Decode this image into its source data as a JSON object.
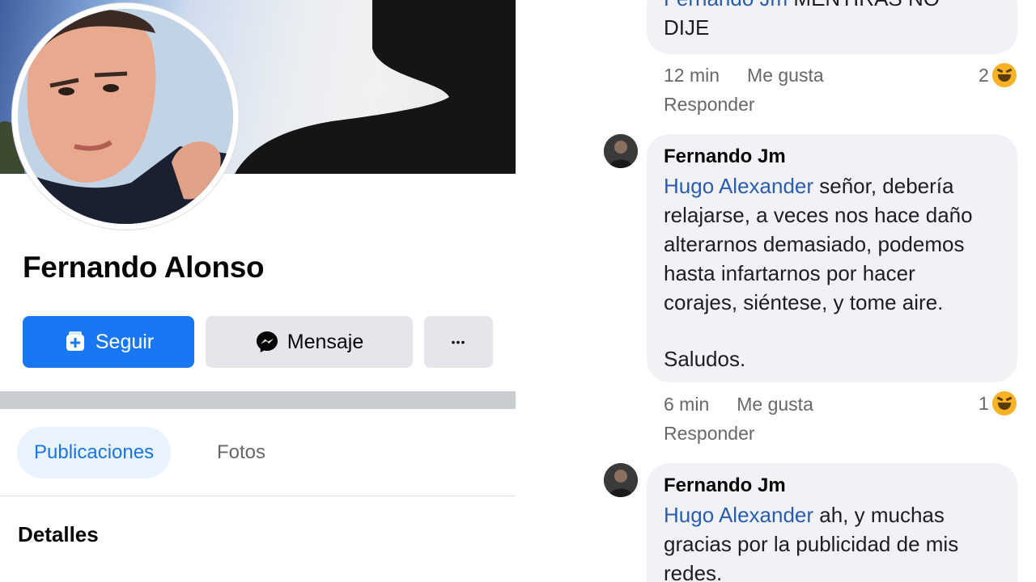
{
  "profile": {
    "name": "Fernando Alonso",
    "follow_label": "Seguir",
    "message_label": "Mensaje",
    "more_label": "•••",
    "tabs": [
      {
        "label": "Publicaciones",
        "active": true
      },
      {
        "label": "Fotos",
        "active": false
      }
    ],
    "details_heading": "Detalles",
    "accent_color": "#1877f2"
  },
  "comments": [
    {
      "author": "",
      "mention": "Fernando Jm",
      "text_line1_rest": " MENTIRAS NO",
      "text_line2": "DIJE",
      "time": "12 min",
      "like_label": "Me gusta",
      "reply_label": "Responder",
      "reaction_count": "2",
      "reaction_icon": "haha-emoji-icon"
    },
    {
      "author": "Fernando Jm",
      "mention": "Hugo Alexander",
      "lines": [
        " señor, debería",
        "relajarse, a veces nos hace daño",
        "alterarnos demasiado, podemos",
        "hasta infartarnos por hacer",
        "corajes, siéntese, y tome aire.",
        "",
        "Saludos."
      ],
      "time": "6 min",
      "like_label": "Me gusta",
      "reply_label": "Responder",
      "reaction_count": "1",
      "reaction_icon": "haha-emoji-icon"
    },
    {
      "author": "Fernando Jm",
      "mention": "Hugo Alexander",
      "lines": [
        " ah, y muchas",
        "gracias por la publicidad de mis",
        "redes."
      ]
    }
  ]
}
